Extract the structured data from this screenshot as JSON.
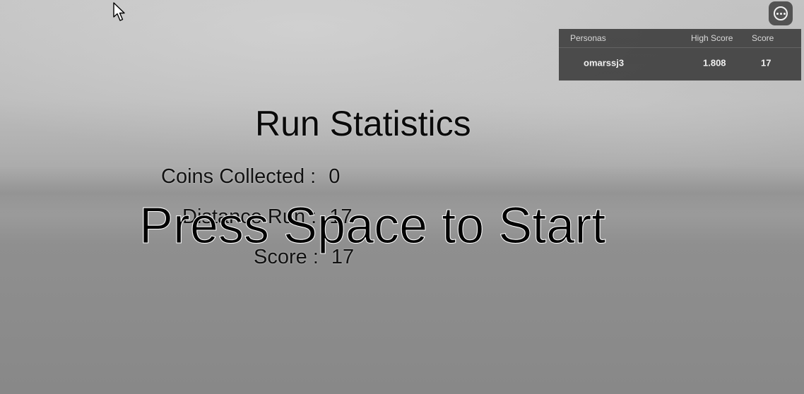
{
  "menu": {
    "icon": "more-options-icon"
  },
  "leaderboard": {
    "headers": {
      "personas": "Personas",
      "high_score": "High Score",
      "score": "Score"
    },
    "rows": [
      {
        "name": "omarssj3",
        "high_score": "1.808",
        "score": "17"
      }
    ]
  },
  "run_stats": {
    "title": "Run Statistics",
    "coins_label": "Coins Collected :",
    "coins_value": "0",
    "distance_label": "Distance Run :",
    "distance_value": "17",
    "score_label": "Score :",
    "score_value": "17"
  },
  "prompt": {
    "start_text": "Press Space to Start"
  },
  "colors": {
    "panel_background": "#303030",
    "text_dark": "#000000",
    "text_light": "#f0f0f0"
  }
}
